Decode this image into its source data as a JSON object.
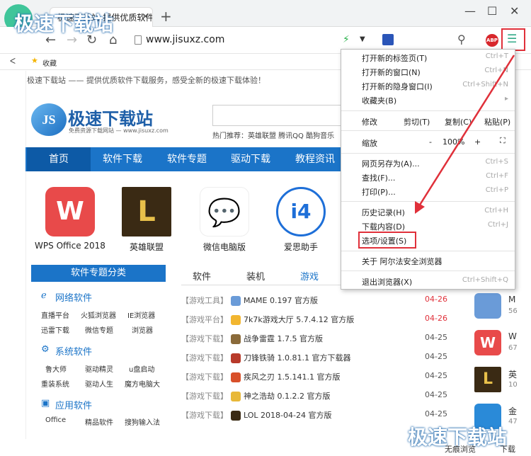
{
  "window": {
    "tab_title": "极速下载站-提供优质软件下载",
    "tab_close": "×",
    "new_tab": "+",
    "minimize": "—",
    "maximize": "☐",
    "close": "✕"
  },
  "address": {
    "url": "www.jisuxz.com",
    "back": "←",
    "forward": "→",
    "reload": "↻",
    "home": "⌂"
  },
  "bookmarks": {
    "collapse": "ᐸ",
    "favorites": "收藏"
  },
  "page": {
    "top_note": "极速下载站 —— 提供优质软件下载服务，感受全新的极速下载体验！",
    "logo_badge": "JS",
    "logo_title": "极速下载站",
    "logo_sub": "免费资源下载网站 — www.jisuxz.com",
    "hot": "热门推荐：英雄联盟  腾讯QQ  酷狗音乐",
    "nav": [
      "首页",
      "软件下载",
      "软件专题",
      "驱动下载",
      "教程资讯"
    ],
    "apps": [
      {
        "label": "WPS Office 2018",
        "color": "#e84a4a",
        "glyph": "W"
      },
      {
        "label": "英雄联盟",
        "color": "#3a2a14",
        "glyph": "L"
      },
      {
        "label": "微信电脑版",
        "color": "#3cc13c",
        "glyph": "💬"
      },
      {
        "label": "爱思助手",
        "color": "#1e6fd8",
        "glyph": "i4"
      }
    ],
    "sidebar_head": "软件专题分类",
    "categories": [
      {
        "name": "网络软件",
        "items": [
          "直播平台",
          "火狐浏览器",
          "IE浏览器",
          "迅雷下载",
          "微信专题",
          "浏览器"
        ]
      },
      {
        "name": "系统软件",
        "items": [
          "鲁大师",
          "驱动精灵",
          "u盘启动",
          "重装系统",
          "驱动人生",
          "魔方电脑大"
        ]
      },
      {
        "name": "应用软件",
        "items": [
          "Office",
          "精品软件",
          "搜狗输入法"
        ]
      }
    ],
    "list_tabs": [
      "软件",
      "装机",
      "游戏"
    ],
    "rows": [
      {
        "tag": "【游戏工具】",
        "name": "MAME 0.197 官方版",
        "date": "04-26",
        "hot": true,
        "icon": "#6a9bd8"
      },
      {
        "tag": "【游戏平台】",
        "name": "7k7k游戏大厅 5.7.4.12 官方版",
        "date": "04-26",
        "hot": true,
        "icon": "#f2b630"
      },
      {
        "tag": "【游戏下载】",
        "name": "战争雷霆 1.7.5 官方版",
        "date": "04-25",
        "hot": false,
        "icon": "#8a6a3a"
      },
      {
        "tag": "【游戏下载】",
        "name": "刀锋铁骑 1.0.81.1 官方下载器",
        "date": "04-25",
        "hot": false,
        "icon": "#b83a2a"
      },
      {
        "tag": "【游戏下载】",
        "name": "疾风之刃 1.5.141.1 官方版",
        "date": "04-25",
        "hot": false,
        "icon": "#d8502a"
      },
      {
        "tag": "【游戏下载】",
        "name": "神之浩劫 0.1.2.2 官方版",
        "date": "04-25",
        "hot": false,
        "icon": "#e8b838"
      },
      {
        "tag": "【游戏下载】",
        "name": "LOL 2018-04-24 官方版",
        "date": "04-25",
        "hot": false,
        "icon": "#3a2a14"
      }
    ],
    "right_labels": [
      "M",
      "56",
      "W",
      "67",
      "英",
      "10",
      "金",
      "47"
    ]
  },
  "menu": {
    "items": [
      {
        "label": "打开新的标签页(T)",
        "key": "Ctrl+T"
      },
      {
        "label": "打开新的窗口(N)",
        "key": "Ctrl+N"
      },
      {
        "label": "打开新的隐身窗口(I)",
        "key": "Ctrl+Shift+N"
      },
      {
        "label": "收藏夹(B)",
        "key": "▸"
      }
    ],
    "edit": {
      "label": "修改",
      "cut": "剪切(T)",
      "copy": "复制(C)",
      "paste": "粘贴(P)"
    },
    "zoom": {
      "label": "缩放",
      "minus": "-",
      "value": "100%",
      "plus": "+"
    },
    "items2": [
      {
        "label": "网页另存为(A)...",
        "key": "Ctrl+S"
      },
      {
        "label": "查找(F)...",
        "key": "Ctrl+F"
      },
      {
        "label": "打印(P)...",
        "key": "Ctrl+P"
      }
    ],
    "items3": [
      {
        "label": "历史记录(H)",
        "key": "Ctrl+H"
      },
      {
        "label": "下载内容(D)",
        "key": "Ctrl+J"
      },
      {
        "label": "选项/设置(S)",
        "key": ""
      }
    ],
    "about": "关于 阿尔法安全浏览器",
    "exit": {
      "label": "退出浏览器(X)",
      "key": "Ctrl+Shift+Q"
    }
  },
  "watermark": "极速下载站",
  "status": {
    "incognito": "无痕浏览",
    "download": "下载"
  },
  "colors": {
    "accent": "#1b74c8",
    "highlight": "#e0303a"
  }
}
